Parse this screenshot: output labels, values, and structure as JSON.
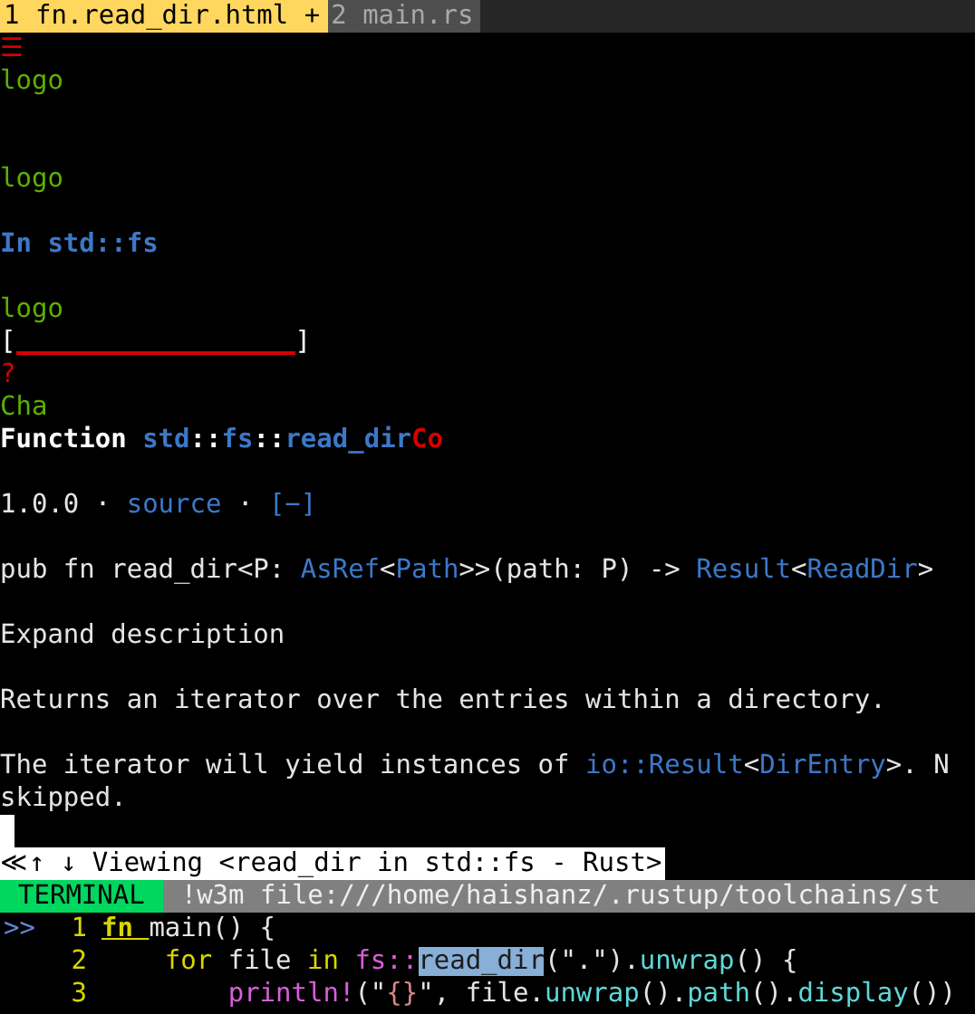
{
  "tabs": [
    {
      "label": "1 fn.read_dir.html +",
      "selected": true
    },
    {
      "label": "2 main.rs",
      "selected": false
    }
  ],
  "browser": {
    "lines": [
      {
        "kind": "text",
        "segments": [
          {
            "text": "☰",
            "kind": "red"
          }
        ]
      },
      {
        "kind": "text",
        "segments": [
          {
            "text": "logo",
            "kind": "green"
          }
        ]
      },
      {
        "kind": "blank"
      },
      {
        "kind": "blank"
      },
      {
        "kind": "text",
        "segments": [
          {
            "text": "logo",
            "kind": "green"
          }
        ]
      },
      {
        "kind": "blank"
      },
      {
        "kind": "text",
        "segments": [
          {
            "text": "In std::fs",
            "kind": "heading"
          }
        ]
      },
      {
        "kind": "blank"
      },
      {
        "kind": "text",
        "segments": [
          {
            "text": "logo",
            "kind": "green"
          }
        ]
      },
      {
        "kind": "field",
        "open": "[",
        "close": "]"
      },
      {
        "kind": "text",
        "segments": [
          {
            "text": "?",
            "kind": "red"
          }
        ]
      },
      {
        "kind": "text",
        "segments": [
          {
            "text": "Cha",
            "kind": "green"
          }
        ]
      },
      {
        "kind": "text",
        "segments": [
          {
            "text": "Function ",
            "kind": "bold"
          },
          {
            "text": "std",
            "kind": "heading"
          },
          {
            "text": "::",
            "kind": "bold"
          },
          {
            "text": "fs",
            "kind": "heading"
          },
          {
            "text": "::",
            "kind": "bold"
          },
          {
            "text": "read_dir",
            "kind": "heading"
          },
          {
            "text": "Co",
            "kind": "redbold"
          }
        ]
      },
      {
        "kind": "blank"
      },
      {
        "kind": "text",
        "segments": [
          {
            "text": "1.0.0 · ",
            "kind": "plain"
          },
          {
            "text": "source",
            "kind": "link"
          },
          {
            "text": " · ",
            "kind": "plain"
          },
          {
            "text": "[−]",
            "kind": "link"
          }
        ]
      },
      {
        "kind": "blank"
      },
      {
        "kind": "text",
        "segments": [
          {
            "text": "pub fn read_dir<P: ",
            "kind": "plain"
          },
          {
            "text": "AsRef",
            "kind": "link"
          },
          {
            "text": "<",
            "kind": "plain"
          },
          {
            "text": "Path",
            "kind": "link"
          },
          {
            "text": ">>(path: P) -> ",
            "kind": "plain"
          },
          {
            "text": "Result",
            "kind": "link"
          },
          {
            "text": "<",
            "kind": "plain"
          },
          {
            "text": "ReadDir",
            "kind": "link"
          },
          {
            "text": ">",
            "kind": "plain"
          }
        ]
      },
      {
        "kind": "blank"
      },
      {
        "kind": "text",
        "segments": [
          {
            "text": "Expand description",
            "kind": "plain"
          }
        ]
      },
      {
        "kind": "blank"
      },
      {
        "kind": "text",
        "segments": [
          {
            "text": "Returns an iterator over the entries within a directory.",
            "kind": "plain"
          }
        ]
      },
      {
        "kind": "blank"
      },
      {
        "kind": "text",
        "segments": [
          {
            "text": "The iterator will yield instances of ",
            "kind": "plain"
          },
          {
            "text": "io::Result",
            "kind": "link"
          },
          {
            "text": "<",
            "kind": "plain"
          },
          {
            "text": "DirEntry",
            "kind": "link"
          },
          {
            "text": ">. N",
            "kind": "plain"
          }
        ]
      },
      {
        "kind": "text",
        "segments": [
          {
            "text": "skipped.",
            "kind": "plain"
          }
        ]
      },
      {
        "kind": "cursor"
      }
    ],
    "status": "≪↑ ↓ Viewing <read_dir in std::fs - Rust>"
  },
  "terminal_bar": {
    "mode": "TERMINAL",
    "command": "!w3m file:///home/haishanz/.rustup/toolchains/st"
  },
  "code": [
    {
      "sign": ">>",
      "number": "1",
      "segments": [
        {
          "text": "fn ",
          "kind": "keywordline"
        },
        {
          "text": "main() {",
          "kind": "plain"
        }
      ]
    },
    {
      "number": "2",
      "segments": [
        {
          "text": "    for",
          "kind": "keyword"
        },
        {
          "text": " file ",
          "kind": "plain"
        },
        {
          "text": "in ",
          "kind": "keyword"
        },
        {
          "text": "fs::",
          "kind": "path"
        },
        {
          "text": "read_dir",
          "kind": "highlight"
        },
        {
          "text": "(\".\").",
          "kind": "plain"
        },
        {
          "text": "unwrap",
          "kind": "func"
        },
        {
          "text": "() {",
          "kind": "plain"
        }
      ]
    },
    {
      "number": "3",
      "segments": [
        {
          "text": "        println!",
          "kind": "path"
        },
        {
          "text": "(\"",
          "kind": "plain"
        },
        {
          "text": "{}",
          "kind": "string"
        },
        {
          "text": "\", file.",
          "kind": "plain"
        },
        {
          "text": "unwrap",
          "kind": "func"
        },
        {
          "text": "().",
          "kind": "plain"
        },
        {
          "text": "path",
          "kind": "func"
        },
        {
          "text": "().",
          "kind": "plain"
        },
        {
          "text": "display",
          "kind": "func"
        },
        {
          "text": "())",
          "kind": "plain"
        }
      ]
    }
  ]
}
